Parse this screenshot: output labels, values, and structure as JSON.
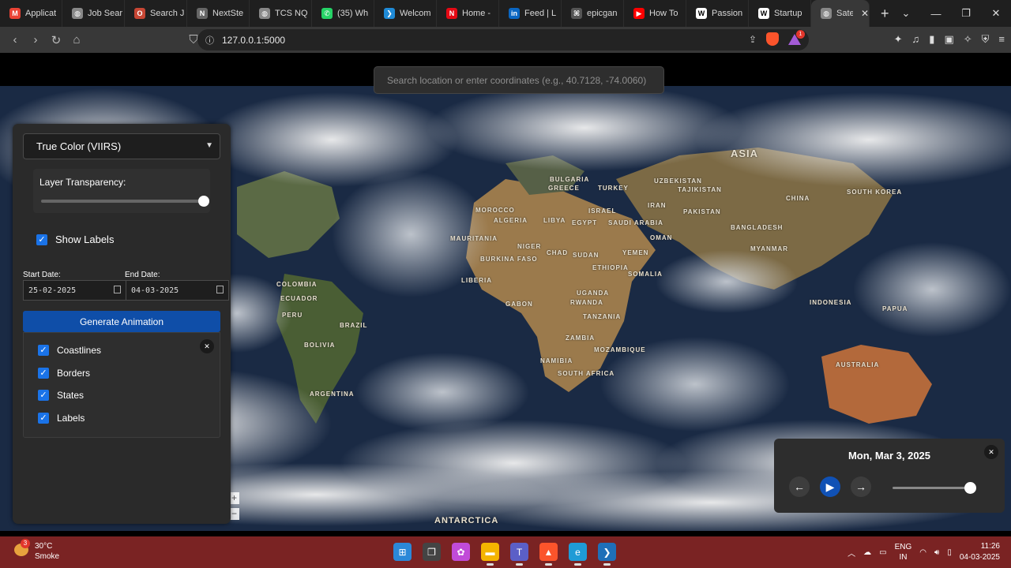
{
  "tabs": [
    {
      "label": "Applicat",
      "icon": "gmail-icon",
      "color": "#ea4335",
      "glyph": "M"
    },
    {
      "label": "Job Sear",
      "icon": "globe-icon",
      "color": "#888888",
      "glyph": "◍"
    },
    {
      "label": "Search J",
      "icon": "oracle-icon",
      "color": "#c74634",
      "glyph": "O"
    },
    {
      "label": "NextSte",
      "icon": "tcs-icon",
      "color": "#666666",
      "glyph": "N"
    },
    {
      "label": "TCS NQ",
      "icon": "globe-icon",
      "color": "#888888",
      "glyph": "◍"
    },
    {
      "label": "(35) Wh",
      "icon": "whatsapp-icon",
      "color": "#25d366",
      "glyph": "✆"
    },
    {
      "label": "Welcom",
      "icon": "vscode-icon",
      "color": "#1f8ad6",
      "glyph": "❯"
    },
    {
      "label": "Home -",
      "icon": "netflix-icon",
      "color": "#e50914",
      "glyph": "N"
    },
    {
      "label": "Feed | L",
      "icon": "linkedin-icon",
      "color": "#0a66c2",
      "glyph": "in"
    },
    {
      "label": "epicgan",
      "icon": "github-icon",
      "color": "#555555",
      "glyph": "⌘"
    },
    {
      "label": "How To",
      "icon": "youtube-icon",
      "color": "#ff0000",
      "glyph": "▶"
    },
    {
      "label": "Passion",
      "icon": "wix-icon",
      "color": "#ffffff",
      "glyph": "W"
    },
    {
      "label": "Startup",
      "icon": "wix-icon",
      "color": "#ffffff",
      "glyph": "W"
    },
    {
      "label": "Satel",
      "icon": "globe-icon",
      "color": "#888888",
      "glyph": "◍",
      "active": true
    }
  ],
  "browser": {
    "url": "127.0.0.1:5000",
    "rewards_badge": "1"
  },
  "map": {
    "search_placeholder": "Search location or enter coordinates (e.g., 40.7128, -74.0060)",
    "zoom_in": "+",
    "zoom_out": "−"
  },
  "panel": {
    "layer_selected": "True Color (VIIRS)",
    "transparency_label": "Layer Transparency:",
    "transparency_value": 1.0,
    "show_labels": "Show Labels",
    "start_date_label": "Start Date:",
    "start_date_value": "25-02-2025",
    "end_date_label": "End Date:",
    "end_date_value": "04-03-2025",
    "generate_button": "Generate Animation",
    "overlays": [
      "Coastlines",
      "Borders",
      "States",
      "Labels"
    ]
  },
  "timeline": {
    "date": "Mon, Mar 3, 2025",
    "position": 0.98
  },
  "taskbar": {
    "temperature": "30°C",
    "weather": "Smoke",
    "weather_badge": "3",
    "lang_1": "ENG",
    "lang_2": "IN",
    "time": "11:26",
    "date": "04-03-2025"
  },
  "map_labels": [
    {
      "text": "ASIA"
    },
    {
      "text": "CHINA"
    },
    {
      "text": "AUSTRALIA"
    },
    {
      "text": "INDONESIA"
    },
    {
      "text": "LIBYA"
    },
    {
      "text": "EGYPT"
    },
    {
      "text": "CHAD"
    },
    {
      "text": "SUDAN"
    },
    {
      "text": "NIGER"
    },
    {
      "text": "MAURITANIA"
    },
    {
      "text": "ALGERIA"
    },
    {
      "text": "IRAN"
    },
    {
      "text": "PAKISTAN"
    },
    {
      "text": "BRAZIL"
    },
    {
      "text": "PERU"
    },
    {
      "text": "BOLIVIA"
    },
    {
      "text": "ARGENTINA"
    },
    {
      "text": "ETHIOPIA"
    },
    {
      "text": "SOMALIA"
    },
    {
      "text": "YEMEN"
    },
    {
      "text": "OMAN"
    },
    {
      "text": "ZAMBIA"
    },
    {
      "text": "NAMIBIA"
    },
    {
      "text": "SOUTH AFRICA"
    },
    {
      "text": "UGANDA"
    },
    {
      "text": "RWANDA"
    },
    {
      "text": "TANZANIA"
    },
    {
      "text": "MOZAMBIQUE"
    },
    {
      "text": "BANGLADESH"
    },
    {
      "text": "MYANMAR"
    },
    {
      "text": "LIBERIA"
    },
    {
      "text": "GABON"
    },
    {
      "text": "BURKINA FASO"
    },
    {
      "text": "MOROCCO"
    },
    {
      "text": "BULGARIA"
    },
    {
      "text": "GREECE"
    },
    {
      "text": "TURKEY"
    },
    {
      "text": "ISRAEL"
    },
    {
      "text": "SAUDI ARABIA"
    },
    {
      "text": "UZBEKISTAN"
    },
    {
      "text": "TAJIKISTAN"
    },
    {
      "text": "SOUTH KOREA"
    },
    {
      "text": "COLOMBIA"
    },
    {
      "text": "ECUADOR"
    },
    {
      "text": "PAPUA"
    },
    {
      "text": "ANTARCTICA"
    }
  ]
}
